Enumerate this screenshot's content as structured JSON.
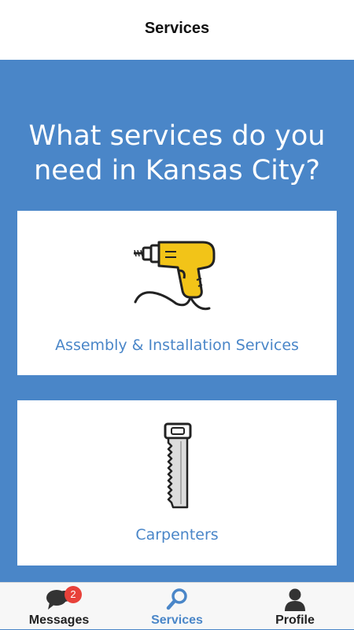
{
  "header": {
    "title": "Services"
  },
  "main": {
    "headline": "What services do you need in Kansas City?",
    "cards": [
      {
        "label": "Assembly & Installation Services",
        "icon": "drill-icon",
        "accent": "#f2c418"
      },
      {
        "label": "Carpenters",
        "icon": "hand-saw-icon"
      }
    ]
  },
  "tabbar": {
    "tabs": [
      {
        "label": "Messages",
        "icon": "chat-bubbles-icon",
        "badge": "2"
      },
      {
        "label": "Services",
        "icon": "search-icon",
        "active": true
      },
      {
        "label": "Profile",
        "icon": "person-icon"
      }
    ]
  },
  "colors": {
    "brand_blue": "#4a86c8",
    "badge_red": "#e8413a",
    "drill_yellow": "#f2c418"
  }
}
